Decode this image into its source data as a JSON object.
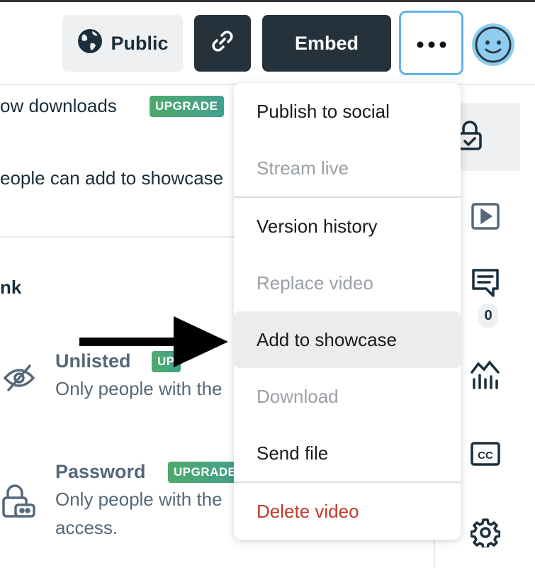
{
  "header": {
    "public_label": "Public",
    "embed_label": "Embed",
    "more_label": "•••"
  },
  "content": {
    "allow_downloads_text": "ow downloads",
    "showcase_text": "eople can add to showcase",
    "link_heading": "nk",
    "upgrade_badge": "UPGRADE",
    "unlisted_title": "Unlisted",
    "unlisted_badge": "UP",
    "unlisted_desc": "Only people with the",
    "password_title": "Password",
    "password_badge": "UPGRADE",
    "password_desc_1": "Only people with the",
    "password_desc_2": "access."
  },
  "menu": {
    "items": [
      {
        "label": "Publish to social",
        "state": "normal"
      },
      {
        "label": "Stream live",
        "state": "disabled"
      },
      {
        "label": "Version history",
        "state": "normal"
      },
      {
        "label": "Replace video",
        "state": "disabled"
      },
      {
        "label": "Add to showcase",
        "state": "hover"
      },
      {
        "label": "Download",
        "state": "disabled"
      },
      {
        "label": "Send file",
        "state": "normal"
      },
      {
        "label": "Delete video",
        "state": "danger"
      }
    ]
  },
  "sidebar": {
    "comment_count": "0",
    "items": [
      "lock-icon",
      "play-icon",
      "comment-icon",
      "stats-icon",
      "cc-icon",
      "gear-icon"
    ]
  },
  "colors": {
    "dark_button": "#25323c",
    "accent_border": "#5fb3e6",
    "danger": "#c0392b",
    "upgrade_green": "#4fa96b"
  }
}
